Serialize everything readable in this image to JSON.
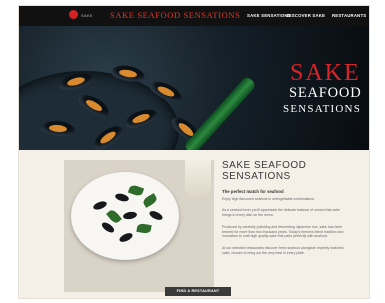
{
  "nav": {
    "brand_small": "SAKE",
    "brand_title": "SAKE SEAFOOD SENSATIONS",
    "links": [
      "SAKE SENSATIONS",
      "DISCOVER SAKE",
      "RESTAURANTS"
    ]
  },
  "hero": {
    "line1": "SAKE",
    "line2": "SEAFOOD",
    "line3": "SENSATIONS",
    "slide_count": 3,
    "active_slide": 1
  },
  "lower": {
    "title1": "SAKE SEAFOOD",
    "title2": "SENSATIONS",
    "subhead": "The perfect match for seafood",
    "paragraphs": [
      "Enjoy high-flavoured seafood in unforgettable combinations.",
      "As a seafood lover you'll appreciate the delicate balance of umami that sake brings to every dish on the menu.",
      "Produced by carefully polishing and fermenting Japanese rice, sake has been brewed for more than two thousand years. Today's brewers blend tradition and innovation to craft high quality sake that pairs perfectly with seafood.",
      "At our selected restaurants discover fresh seafood alongside expertly matched sake, chosen to bring out the very best in every plate."
    ],
    "button_label": "FIND A RESTAURANT"
  },
  "colors": {
    "accent_red": "#d7242a",
    "topbar": "#111111",
    "page_bg": "#f4efe7"
  }
}
